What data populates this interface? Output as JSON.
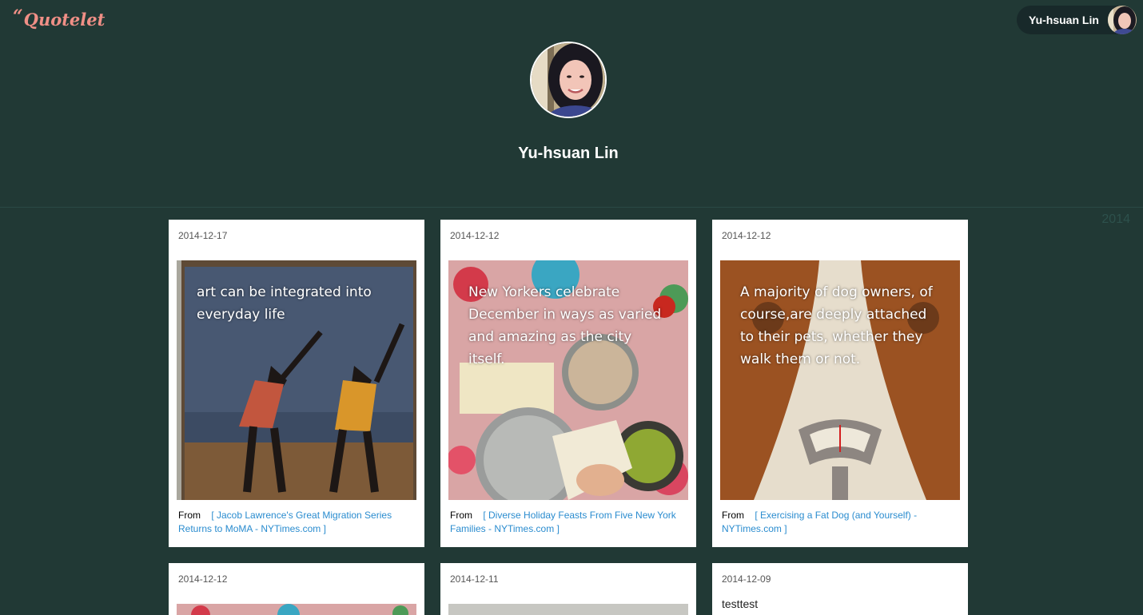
{
  "header": {
    "logo_mark": "“",
    "logo_text": "Quotelet",
    "user_name": "Yu-hsuan Lin"
  },
  "profile": {
    "name": "Yu-hsuan Lin"
  },
  "timeline": {
    "year": "2014"
  },
  "cards": [
    {
      "date": "2014-12-17",
      "quote": "art can be integrated into everyday life",
      "from_label": "From",
      "link_text": "[ Jacob Lawrence's Great Migration Series Returns to MoMA - NYTimes.com ]"
    },
    {
      "date": "2014-12-12",
      "quote": "New Yorkers celebrate December in ways as varied and amazing as the city itself.",
      "from_label": "From",
      "link_text": "[ Diverse Holiday Feasts From Five New York Families - NYTimes.com ]"
    },
    {
      "date": "2014-12-12",
      "quote": "A majority of dog owners, of course,are deeply attached to their pets, whether they walk them or not.",
      "from_label": "From",
      "link_text": "[ Exercising a Fat Dog (and Yourself) - NYTimes.com ]"
    },
    {
      "date": "2014-12-12"
    },
    {
      "date": "2014-12-11"
    },
    {
      "date": "2014-12-09",
      "note": "testtest"
    }
  ]
}
